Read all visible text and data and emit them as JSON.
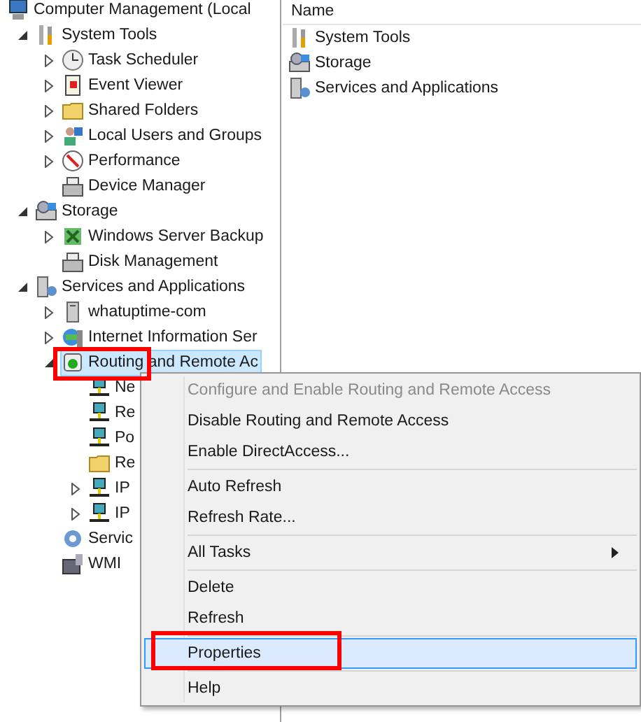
{
  "tree": [
    {
      "label": "Computer Management (Local",
      "selected": false,
      "children": [
        {
          "label": "System Tools",
          "expanded": true,
          "selected": false,
          "children": [
            {
              "label": "Task Scheduler",
              "expanded": false,
              "selected": false
            },
            {
              "label": "Event Viewer",
              "expanded": false,
              "selected": false
            },
            {
              "label": "Shared Folders",
              "expanded": false,
              "selected": false
            },
            {
              "label": "Local Users and Groups",
              "expanded": false,
              "selected": false
            },
            {
              "label": "Performance",
              "expanded": false,
              "selected": false
            },
            {
              "label": "Device Manager",
              "selected": false
            }
          ]
        },
        {
          "label": "Storage",
          "expanded": true,
          "selected": false,
          "children": [
            {
              "label": "Windows Server Backup",
              "expanded": false,
              "selected": false
            },
            {
              "label": "Disk Management",
              "selected": false
            }
          ]
        },
        {
          "label": "Services and Applications",
          "expanded": true,
          "selected": false,
          "children": [
            {
              "label": "whatuptime-com",
              "expanded": false,
              "selected": false
            },
            {
              "label": "Internet Information Ser",
              "expanded": false,
              "selected": false
            },
            {
              "label": "Routing and Remote Ac",
              "expanded": true,
              "selected": true,
              "children": [
                {
                  "label": "Ne",
                  "selected": false
                },
                {
                  "label": "Re",
                  "selected": false
                },
                {
                  "label": "Po",
                  "selected": false
                },
                {
                  "label": "Re",
                  "selected": false
                },
                {
                  "label": "IP",
                  "expanded": false,
                  "selected": false
                },
                {
                  "label": "IP",
                  "expanded": false,
                  "selected": false
                }
              ]
            },
            {
              "label": "Servic",
              "selected": false
            },
            {
              "label": "WMI",
              "selected": false
            }
          ]
        }
      ]
    }
  ],
  "list": {
    "column": "Name",
    "items": [
      "System Tools",
      "Storage",
      "Services and Applications"
    ]
  },
  "menu": [
    {
      "kind": "item",
      "label": "Configure and Enable Routing and Remote Access",
      "disabled": true,
      "selected": false,
      "submenu": false
    },
    {
      "kind": "item",
      "label": "Disable Routing and Remote Access",
      "disabled": false,
      "selected": false,
      "submenu": false
    },
    {
      "kind": "item",
      "label": "Enable DirectAccess...",
      "disabled": false,
      "selected": false,
      "submenu": false
    },
    {
      "kind": "separator"
    },
    {
      "kind": "item",
      "label": "Auto Refresh",
      "disabled": false,
      "selected": false,
      "submenu": false
    },
    {
      "kind": "item",
      "label": "Refresh Rate...",
      "disabled": false,
      "selected": false,
      "submenu": false
    },
    {
      "kind": "separator"
    },
    {
      "kind": "item",
      "label": "All Tasks",
      "disabled": false,
      "selected": false,
      "submenu": true
    },
    {
      "kind": "separator"
    },
    {
      "kind": "item",
      "label": "Delete",
      "disabled": false,
      "selected": false,
      "submenu": false
    },
    {
      "kind": "item",
      "label": "Refresh",
      "disabled": false,
      "selected": false,
      "submenu": false
    },
    {
      "kind": "separator"
    },
    {
      "kind": "item",
      "label": "Properties",
      "disabled": false,
      "selected": true,
      "submenu": false
    },
    {
      "kind": "separator"
    },
    {
      "kind": "item",
      "label": "Help",
      "disabled": false,
      "selected": false,
      "submenu": false
    }
  ]
}
